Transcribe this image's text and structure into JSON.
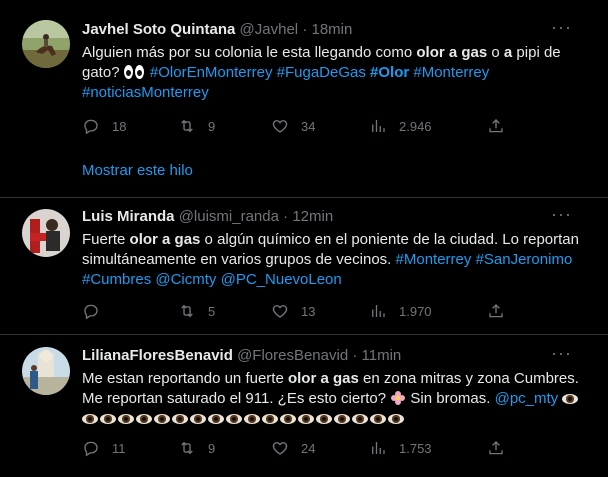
{
  "tweets": [
    {
      "name": "Javhel Soto Quintana",
      "handle": "@Javhel",
      "sep": "·",
      "time": "18min",
      "more": "···",
      "text": {
        "p1": "Alguien más por su colonia le esta llegando como ",
        "b1": "olor a gas",
        "p2": " o ",
        "b2": "a",
        "p3": " pipi de gato? ",
        "h1": "#OlorEnMonterrey",
        "h2": "#FugaDeGas",
        "h3": "#Olor",
        "h4": "#Monterrey",
        "h5": "#noticiasMonterrey"
      },
      "replies": "18",
      "retweets": "9",
      "likes": "34",
      "views": "2.946",
      "show_thread": "Mostrar este hilo"
    },
    {
      "name": "Luis Miranda",
      "handle": "@luismi_randa",
      "sep": "·",
      "time": "12min",
      "more": "···",
      "text": {
        "p1": "Fuerte ",
        "b1": "olor a gas",
        "p2": " o algún químico en el poniente de la ciudad. Lo reportan simultáneamente en varios grupos de vecinos. ",
        "h1": "#Monterrey",
        "h2": "#SanJeronimo",
        "h3": "#Cumbres",
        "h4": "@Cicmty",
        "h5": "@PC_NuevoLeon"
      },
      "replies": "",
      "retweets": "5",
      "likes": "13",
      "views": "1.970"
    },
    {
      "name": "LilianaFloresBenavid",
      "handle": "@FloresBenavid",
      "sep": "·",
      "time": "11min",
      "more": "···",
      "text": {
        "p1": "Me estan reportando un fuerte ",
        "b1": "olor a gas",
        "p2": " en zona mitras y zona Cumbres. Me reportan saturado el 911. ¿Es esto cierto? ",
        "p3": " Sin bromas. ",
        "h1": "@pc_mty"
      },
      "replies": "11",
      "retweets": "9",
      "likes": "24",
      "views": "1.753"
    }
  ],
  "icons": {
    "reply": "reply-icon",
    "retweet": "retweet-icon",
    "like": "heart-icon",
    "views": "views-icon",
    "share": "share-icon",
    "eyes": "eyes-emoji",
    "eye": "eye-emoji",
    "flower": "flower-emoji"
  },
  "colors": {
    "background": "#000000",
    "text": "#e7e9ea",
    "muted": "#71767b",
    "link": "#1d9bf0",
    "divider": "#2f3336"
  }
}
